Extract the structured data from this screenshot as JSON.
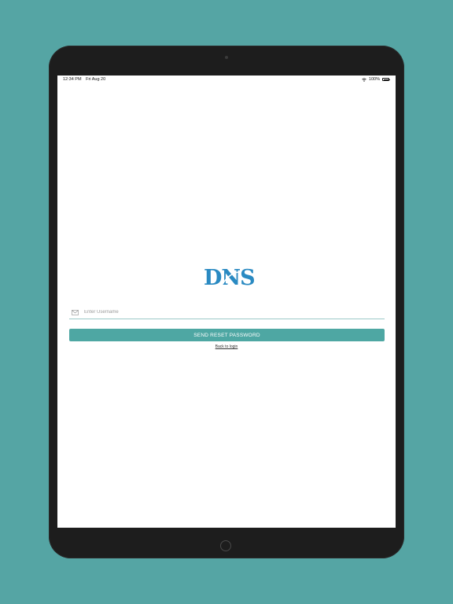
{
  "status_bar": {
    "time": "12:34 PM",
    "date": "Fri Aug 20",
    "battery": "100%"
  },
  "logo": {
    "text": "DNS",
    "color": "#2a8ac2"
  },
  "form": {
    "username_placeholder": "Enter Username",
    "username_value": "",
    "send_button_label": "SEND RESET PASSWORD",
    "back_link_label": "Back to login"
  },
  "colors": {
    "background": "#55a5a4",
    "accent": "#4ea7a3"
  },
  "icons": {
    "username": "mail-icon",
    "wifi": "wifi-icon",
    "battery": "battery-icon"
  }
}
